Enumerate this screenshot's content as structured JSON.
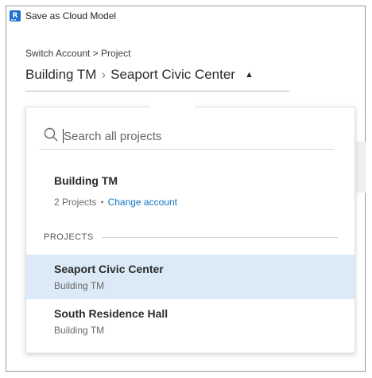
{
  "window": {
    "title": "Save as Cloud Model",
    "app_icon_letter": "R",
    "app_icon_sub": "RVT"
  },
  "breadcrumb": {
    "label": "Switch Account > Project",
    "account": "Building TM",
    "separator": "›",
    "project": "Seaport Civic Center",
    "caret": "▲"
  },
  "dropdown": {
    "search_placeholder": "Search all projects",
    "account": {
      "name": "Building TM",
      "project_count": "2 Projects",
      "dot": "•",
      "change_link": "Change account"
    },
    "section_label": "PROJECTS",
    "projects": [
      {
        "name": "Seaport Civic Center",
        "account": "Building TM",
        "selected": true
      },
      {
        "name": "South Residence Hall",
        "account": "Building TM",
        "selected": false
      }
    ]
  },
  "colors": {
    "accent_link": "#0f75bd",
    "selected_row": "#dbeaf6",
    "app_icon": "#1f6fd1"
  },
  "icons": {
    "search": "search-icon",
    "app": "revit-app-icon"
  }
}
